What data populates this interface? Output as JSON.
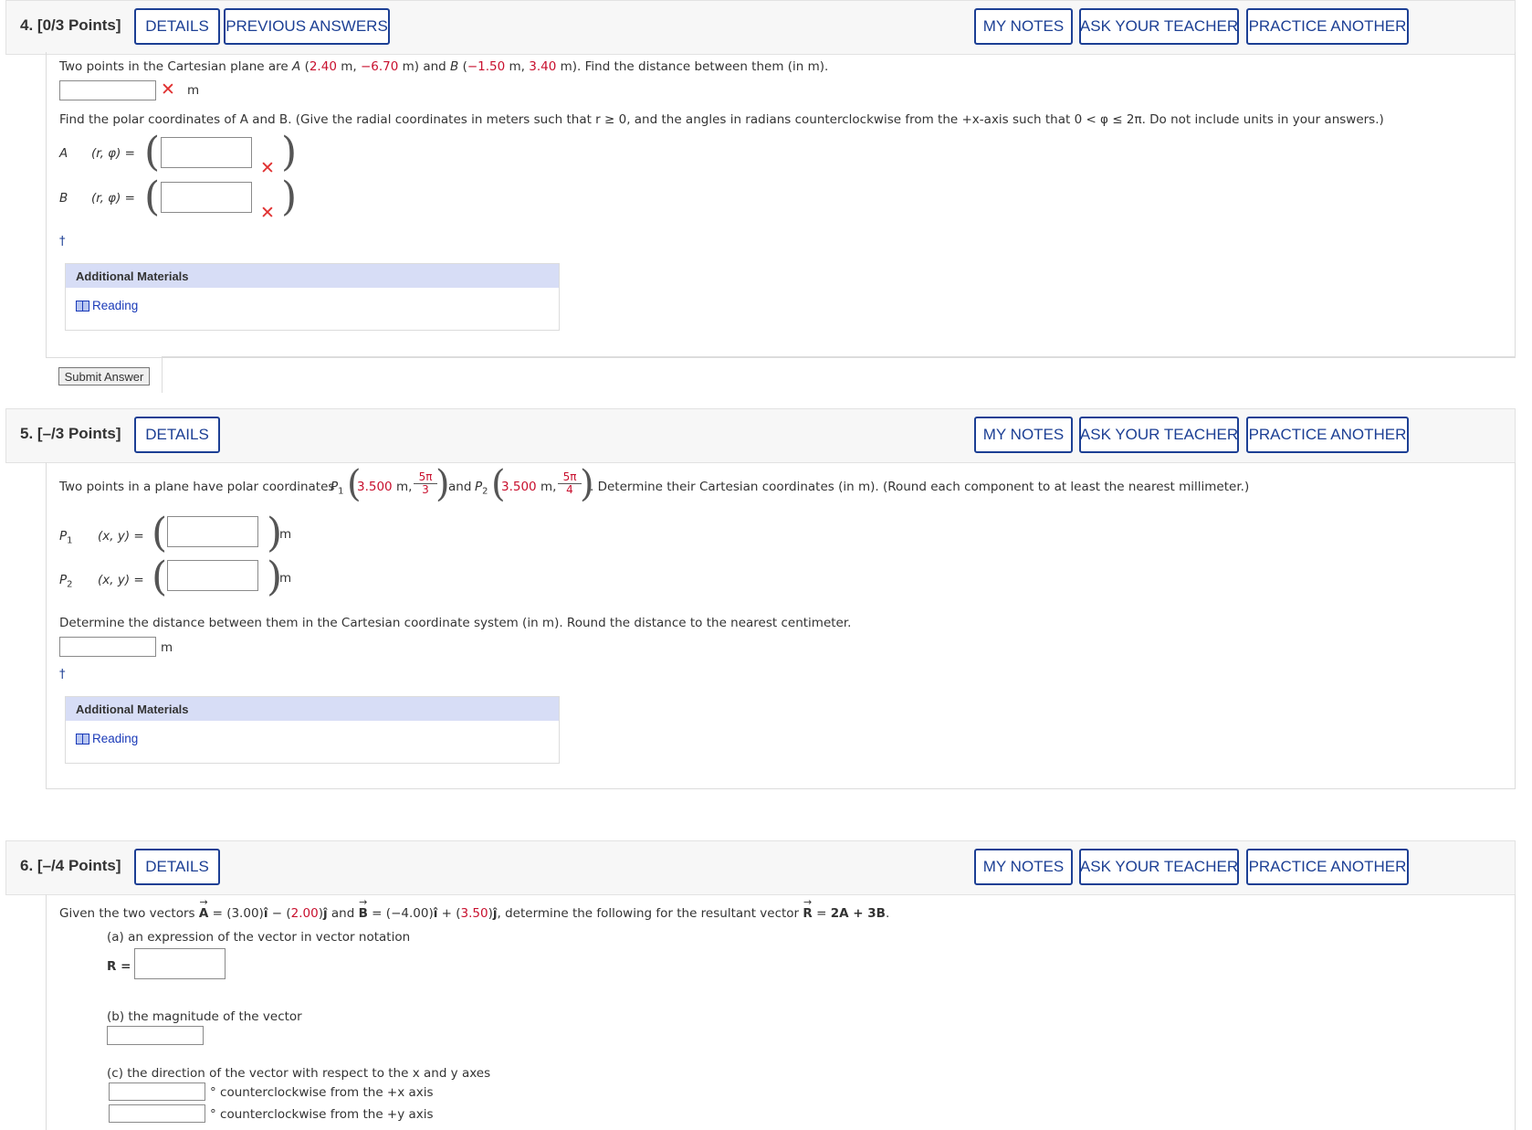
{
  "buttons": {
    "details": "DETAILS",
    "previous_answers": "PREVIOUS ANSWERS",
    "my_notes": "MY NOTES",
    "ask_teacher": "ASK YOUR TEACHER",
    "practice_another": "PRACTICE ANOTHER",
    "submit_answer": "Submit Answer"
  },
  "additional_materials": {
    "title": "Additional Materials",
    "reading": "Reading"
  },
  "common": {
    "m": "m",
    "eq": "=",
    "dagger": "†",
    "rphi": "(r, φ)",
    "xy": "(x, y)"
  },
  "q4": {
    "number": "4.",
    "points": "[0/3 Points]",
    "prompt_pre": "Two points in the Cartesian plane are ",
    "A": "A",
    "A_x": "2.40",
    "A_y": "−6.70",
    "B": "B",
    "B_x": "−1.50",
    "B_y": "3.40",
    "prompt_post": "Find the distance between them (in m).",
    "polar_prompt": "Find the polar coordinates of A and B. (Give the radial coordinates in meters such that r ≥ 0, and the angles in radians counterclockwise from the +x-axis such that 0 < φ ≤ 2π. Do not include units in your answers.)",
    "label_A": "A",
    "label_B": "B"
  },
  "q5": {
    "number": "5.",
    "points": "[–/3 Points]",
    "prompt_pre": "Two points in a plane have polar coordinates ",
    "P1": "P",
    "P1_sub": "1",
    "P1_r": "3.500",
    "P1_num": "5π",
    "P1_den": "3",
    "and": "and",
    "P2": "P",
    "P2_sub": "2",
    "P2_r": "3.500",
    "P2_num": "5π",
    "P2_den": "4",
    "prompt_post": ". Determine their Cartesian coordinates (in m). (Round each component to at least the nearest millimeter.)",
    "distance_prompt": "Determine the distance between them in the Cartesian coordinate system (in m). Round the distance to the nearest centimeter."
  },
  "q6": {
    "number": "6.",
    "points": "[–/4 Points]",
    "prompt_pre": "Given the two vectors ",
    "A": "A",
    "a_x": "3.00",
    "a_y": "2.00",
    "B": "B",
    "b_x": "−4.00",
    "b_y": "3.50",
    "prompt_post": ", determine the following for the resultant vector ",
    "R": "R",
    "R_expr": "2A + 3B",
    "part_a": "(a) an expression of the vector in vector notation",
    "R_eq": "R =",
    "part_b": "(b) the magnitude of the vector",
    "part_c": "(c) the direction of the vector with respect to the x and y axes",
    "ccw_x": "° counterclockwise from the +x axis",
    "ccw_y": "° counterclockwise from the +y axis"
  },
  "colors": {
    "accent": "#1c3f94",
    "given_value": "#c8102e",
    "wrong": "#e03030",
    "materials_header": "#d7ddf6"
  }
}
